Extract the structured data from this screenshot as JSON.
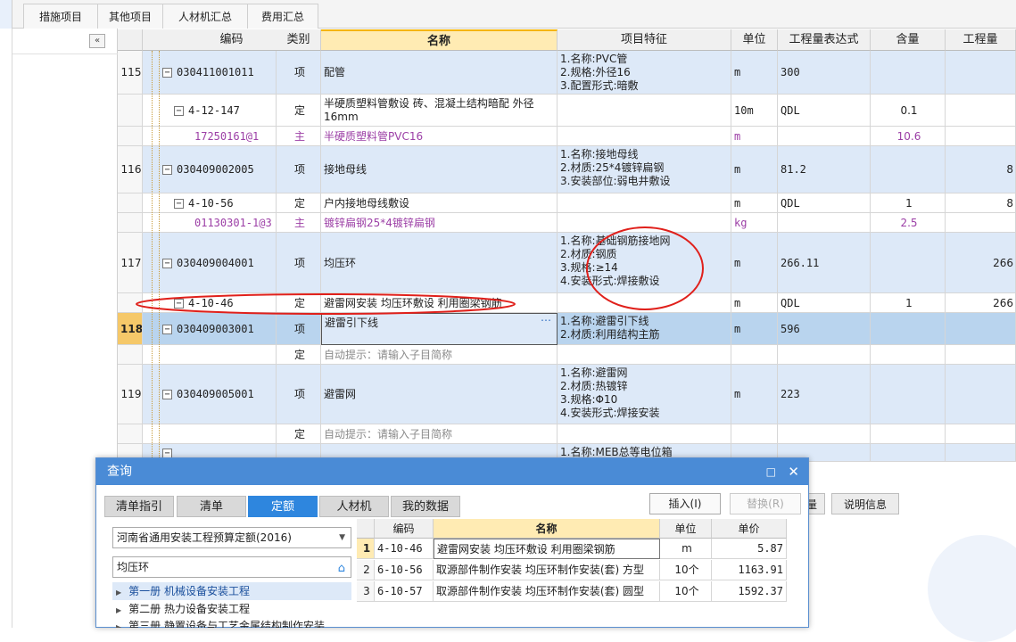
{
  "top_tabs": [
    "措施项目",
    "其他项目",
    "人材机汇总",
    "费用汇总"
  ],
  "grid": {
    "headers": [
      "编码",
      "类别",
      "名称",
      "项目特征",
      "单位",
      "工程量表达式",
      "含量",
      "工程量"
    ],
    "rows": [
      {
        "num": "115",
        "code": "030411001011",
        "type": "项",
        "name": "配管",
        "features": [
          "1.名称:PVC管",
          "2.规格:外径16",
          "3.配置形式:暗敷"
        ],
        "unit": "m",
        "expr": "300",
        "qty": "",
        "amount": ""
      },
      {
        "num": "",
        "code": "4-12-147",
        "type": "定",
        "name": "半硬质塑料管敷设 砖、混凝土结构暗配 外径16mm",
        "features": [],
        "unit": "10m",
        "expr": "QDL",
        "qty": "0.1",
        "amount": ""
      },
      {
        "num": "",
        "code": "17250161@1",
        "type": "主",
        "name": "半硬质塑料管PVC16",
        "features": [],
        "unit": "m",
        "expr": "",
        "qty": "10.6",
        "amount": ""
      },
      {
        "num": "116",
        "code": "030409002005",
        "type": "项",
        "name": "接地母线",
        "features": [
          "1.名称:接地母线",
          "2.材质:25*4镀锌扁钢",
          "3.安装部位:弱电井敷设"
        ],
        "unit": "m",
        "expr": "81.2",
        "qty": "",
        "amount": "8"
      },
      {
        "num": "",
        "code": "4-10-56",
        "type": "定",
        "name": "户内接地母线敷设",
        "features": [],
        "unit": "m",
        "expr": "QDL",
        "qty": "1",
        "amount": "8"
      },
      {
        "num": "",
        "code": "01130301-1@3",
        "type": "主",
        "name": "镀锌扁钢25*4镀锌扁钢",
        "features": [],
        "unit": "kg",
        "expr": "",
        "qty": "2.5",
        "amount": ""
      },
      {
        "num": "117",
        "code": "030409004001",
        "type": "项",
        "name": "均压环",
        "features": [
          "1.名称:基础钢筋接地网",
          "2.材质:钢质",
          "3.规格:≥14",
          "4.安装形式:焊接敷设"
        ],
        "unit": "m",
        "expr": "266.11",
        "qty": "",
        "amount": "266"
      },
      {
        "num": "",
        "code": "4-10-46",
        "type": "定",
        "name": "避雷网安装 均压环敷设 利用圈梁钢筋",
        "features": [],
        "unit": "m",
        "expr": "QDL",
        "qty": "1",
        "amount": "266"
      },
      {
        "num": "118",
        "code": "030409003001",
        "type": "项",
        "name": "避雷引下线",
        "features": [
          "1.名称:避雷引下线",
          "2.材质:利用结构主筋"
        ],
        "unit": "m",
        "expr": "596",
        "qty": "",
        "amount": ""
      },
      {
        "num": "",
        "code": "",
        "type": "定",
        "name": "自动提示：请输入子目简称",
        "features": [],
        "unit": "",
        "expr": "",
        "qty": "",
        "amount": ""
      },
      {
        "num": "119",
        "code": "030409005001",
        "type": "项",
        "name": "避雷网",
        "features": [
          "1.名称:避雷网",
          "2.材质:热镀锌",
          "3.规格:Φ10",
          "4.安装形式:焊接安装"
        ],
        "unit": "m",
        "expr": "223",
        "qty": "",
        "amount": ""
      },
      {
        "num": "",
        "code": "",
        "type": "定",
        "name": "自动提示：请输入子目简称",
        "features": [],
        "unit": "",
        "expr": "",
        "qty": "",
        "amount": ""
      },
      {
        "num": "",
        "code": "",
        "type": "",
        "name": "",
        "features": [
          "1.名称:MEB总等电位箱"
        ],
        "unit": "",
        "expr": "",
        "qty": "",
        "amount": ""
      }
    ]
  },
  "dialog": {
    "title": "查询",
    "tabs": [
      "清单指引",
      "清单",
      "定额",
      "人材机",
      "我的数据"
    ],
    "insert_btn": "插入(I)",
    "replace_btn": "替换(R)",
    "quota_lib": "河南省通用安装工程预算定额(2016)",
    "search_value": "均压环",
    "tree": [
      "第一册 机械设备安装工程",
      "第二册 热力设备安装工程",
      "第三册 静置设备与工艺金属结构制作安装"
    ],
    "headers": [
      "编码",
      "名称",
      "单位",
      "单价"
    ],
    "rows": [
      {
        "n": "1",
        "code": "4-10-46",
        "name": "避雷网安装 均压环敷设 利用圈梁钢筋",
        "unit": "m",
        "price": "5.87"
      },
      {
        "n": "2",
        "code": "6-10-56",
        "name": "取源部件制作安装 均压环制作安装(套) 方型",
        "unit": "10个",
        "price": "1163.91"
      },
      {
        "n": "3",
        "code": "6-10-57",
        "name": "取源部件制作安装 均压环制作安装(套) 圆型",
        "unit": "10个",
        "price": "1592.37"
      }
    ]
  },
  "bottom_tabs": [
    "量",
    "说明信息"
  ]
}
